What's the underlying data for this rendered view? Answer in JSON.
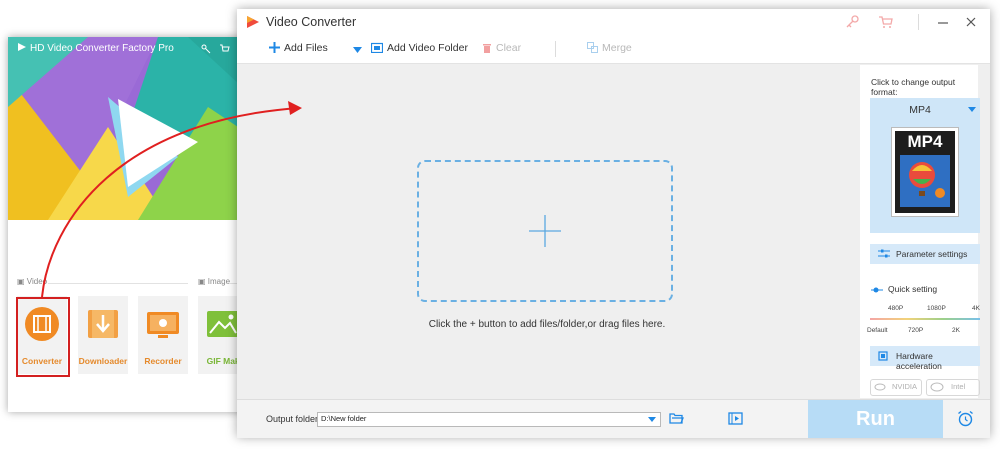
{
  "launcher": {
    "title": "HD Video Converter Factory Pro",
    "sections": {
      "video": "Video",
      "image": "Image"
    },
    "tools": [
      {
        "label": "Converter",
        "icon": "film-reel-icon"
      },
      {
        "label": "Downloader",
        "icon": "download-icon"
      },
      {
        "label": "Recorder",
        "icon": "screen-record-icon"
      },
      {
        "label": "GIF Make",
        "icon": "gif-image-icon"
      }
    ]
  },
  "window": {
    "title": "Video Converter",
    "toolbar": {
      "add_files": "Add Files",
      "add_video_folder": "Add Video Folder",
      "clear": "Clear",
      "merge": "Merge"
    },
    "drop_hint": "Click the + button to add files/folder,or drag files here.",
    "right_panel": {
      "change_format_label": "Click to change output format:",
      "format": "MP4",
      "format_badge": "MP4",
      "parameter_settings": "Parameter settings",
      "quick_setting": "Quick setting",
      "ticks_top": [
        "480P",
        "1080P",
        "4K"
      ],
      "ticks_bottom": [
        "Default",
        "720P",
        "2K"
      ],
      "hardware_acceleration": "Hardware acceleration",
      "gpu_nvidia": "NVIDIA",
      "gpu_intel": "Intel"
    },
    "bottom": {
      "output_folder_label": "Output folder:",
      "output_folder_value": "D:\\New folder",
      "run": "Run"
    }
  },
  "colors": {
    "accent_blue": "#1e88e5",
    "run_button": "#b7dcf6",
    "converter_orange": "#f08a24",
    "highlight_red": "#d32020"
  }
}
